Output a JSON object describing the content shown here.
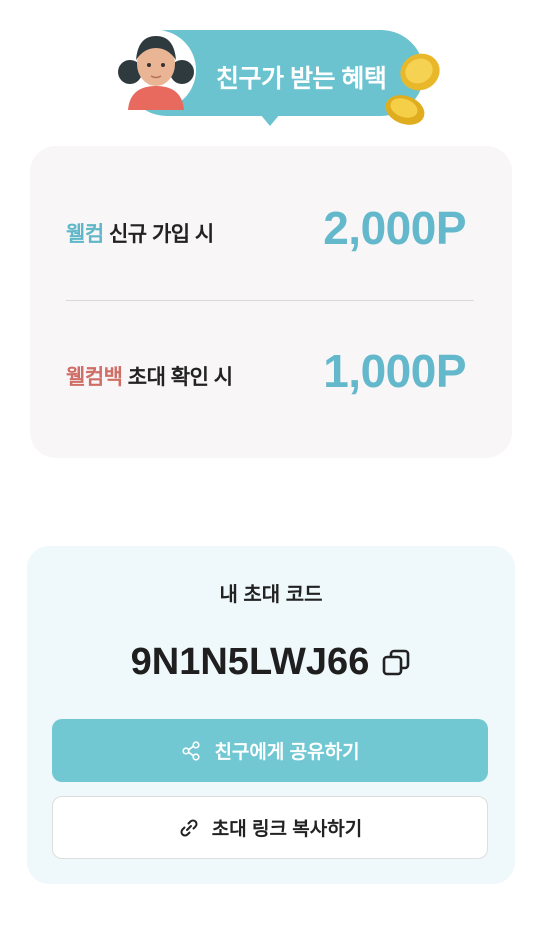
{
  "header": {
    "title": "친구가 받는 혜택"
  },
  "benefits": [
    {
      "highlight": "웰컴",
      "label": " 신규 가입 시",
      "value": "2,000P"
    },
    {
      "highlight": "웰컴백",
      "label": " 초대 확인 시",
      "value": "1,000P"
    }
  ],
  "invite": {
    "title": "내 초대 코드",
    "code": "9N1N5LWJ66",
    "share_button": "친구에게 공유하기",
    "copy_link_button": "초대 링크 복사하기"
  },
  "colors": {
    "accent": "#6cc3d0",
    "value_blue": "#64b8cb",
    "highlight_red": "#cf6e66",
    "card_bg": "#f8f6f7",
    "invite_bg": "#eff8fa"
  },
  "icons": [
    "avatar-illustration",
    "coins-icon",
    "copy-icon",
    "share-icon",
    "link-icon"
  ]
}
